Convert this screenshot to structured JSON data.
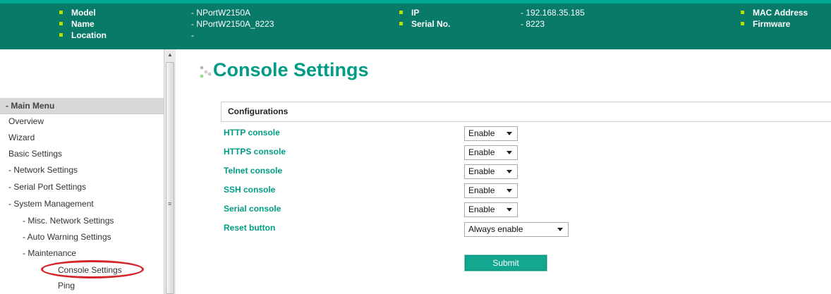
{
  "header": {
    "col1": [
      {
        "label": "Model",
        "value": "- NPortW2150A"
      },
      {
        "label": "Name",
        "value": "- NPortW2150A_8223"
      },
      {
        "label": "Location",
        "value": "-"
      }
    ],
    "col2": [
      {
        "label": "IP",
        "value": "- 192.168.35.185"
      },
      {
        "label": "Serial No.",
        "value": "- 8223"
      }
    ],
    "col3": [
      {
        "label": "MAC Address"
      },
      {
        "label": "Firmware"
      }
    ]
  },
  "sidebar": {
    "menu_head": "- Main Menu",
    "items": [
      {
        "label": "Overview"
      },
      {
        "label": "Wizard"
      },
      {
        "label": "Basic Settings"
      },
      {
        "label": "- Network Settings"
      },
      {
        "label": "- Serial Port Settings"
      },
      {
        "label": "- System Management"
      },
      {
        "label": "- Misc. Network Settings"
      },
      {
        "label": "- Auto Warning Settings"
      },
      {
        "label": "- Maintenance"
      },
      {
        "label": "Console Settings"
      },
      {
        "label": "Ping"
      }
    ]
  },
  "page": {
    "title": "Console Settings",
    "section": "Configurations",
    "fields": [
      {
        "label": "HTTP console",
        "value": "Enable"
      },
      {
        "label": "HTTPS console",
        "value": "Enable"
      },
      {
        "label": "Telnet console",
        "value": "Enable"
      },
      {
        "label": "SSH console",
        "value": "Enable"
      },
      {
        "label": "Serial console",
        "value": "Enable"
      },
      {
        "label": "Reset button",
        "value": "Always enable"
      }
    ],
    "submit_label": "Submit"
  },
  "colors": {
    "header_bg": "#0a7a68",
    "accent": "#009c85",
    "bullet": "#b6e000",
    "highlight_circle": "#d6252a"
  }
}
